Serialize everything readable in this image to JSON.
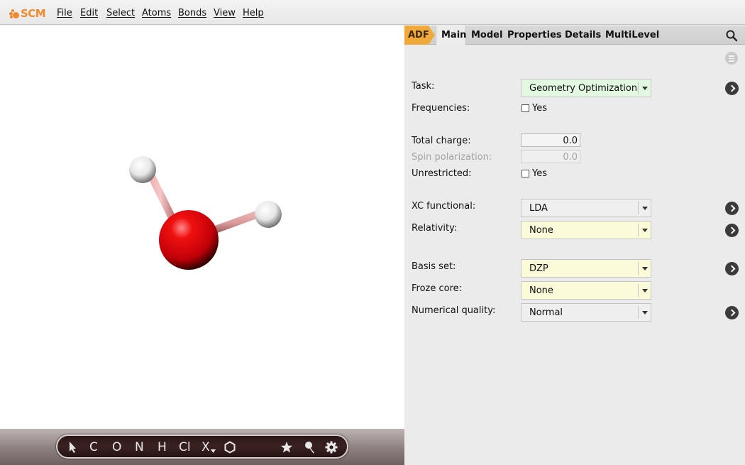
{
  "app": {
    "logo_text": "SCM",
    "accent": "#f08a2c"
  },
  "menu": [
    "File",
    "Edit",
    "Select",
    "Atoms",
    "Bonds",
    "View",
    "Help"
  ],
  "toolbar": {
    "items": [
      "C",
      "O",
      "N",
      "H",
      "Cl",
      "X"
    ],
    "icons": [
      "select-arrow-icon",
      "ring-icon",
      "star-icon",
      "pin-icon",
      "gear-icon"
    ]
  },
  "molecule": {
    "atoms": [
      {
        "element": "O",
        "color": "#e8000a"
      },
      {
        "element": "H",
        "color": "#ffffff"
      },
      {
        "element": "H",
        "color": "#ffffff"
      }
    ]
  },
  "panel": {
    "tabs": [
      "ADF",
      "Main",
      "Model",
      "Properties",
      "Details",
      "MultiLevel"
    ],
    "active_tab": "Main",
    "fields": {
      "task": {
        "label": "Task:",
        "value": "Geometry Optimization"
      },
      "frequencies": {
        "label": "Frequencies:",
        "checkbox": "Yes",
        "checked": false
      },
      "total_charge": {
        "label": "Total charge:",
        "value": "0.0"
      },
      "spin_polarization": {
        "label": "Spin polarization:",
        "value": "0.0",
        "enabled": false
      },
      "unrestricted": {
        "label": "Unrestricted:",
        "checkbox": "Yes",
        "checked": false
      },
      "xc_functional": {
        "label": "XC functional:",
        "value": "LDA"
      },
      "relativity": {
        "label": "Relativity:",
        "value": "None"
      },
      "basis_set": {
        "label": "Basis set:",
        "value": "DZP"
      },
      "froze_core": {
        "label": "Froze core:",
        "value": "None"
      },
      "numerical_quality": {
        "label": "Numerical quality:",
        "value": "Normal"
      }
    }
  }
}
